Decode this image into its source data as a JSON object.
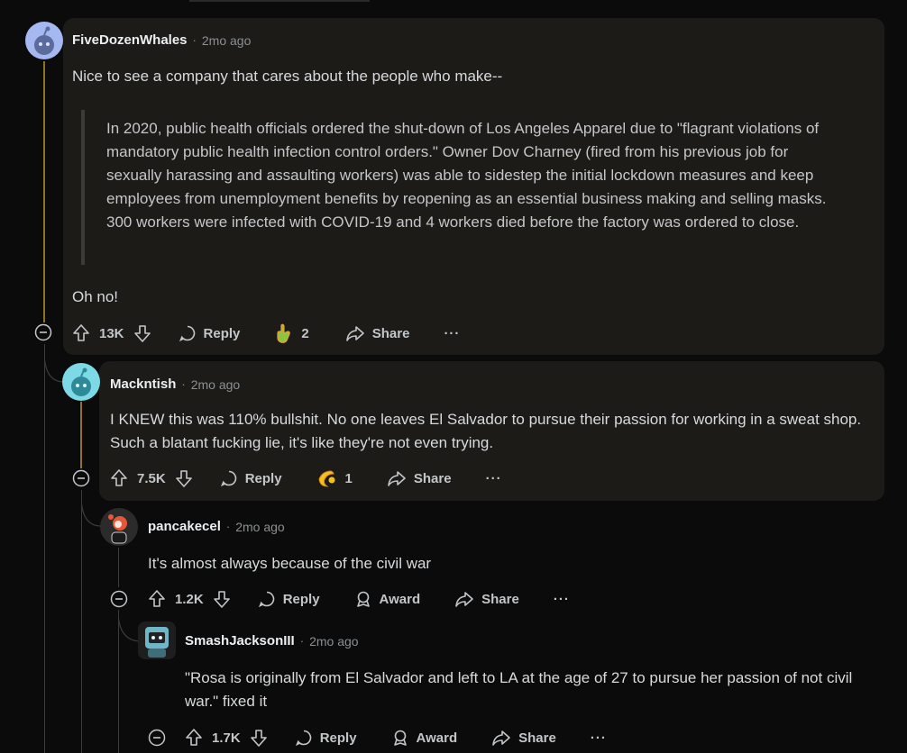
{
  "comments": [
    {
      "user": "FiveDozenWhales",
      "age": "2mo ago",
      "text1": "Nice to see a company that cares about the people who make--",
      "quote": "In 2020, public health officials ordered the shut-down of Los Angeles Apparel due to \"flagrant violations of mandatory public health infection control orders.\" Owner Dov Charney (fired from his previous job for sexually harassing and assaulting workers) was able to sidestep the initial lockdown measures and keep employees from unemployment benefits by reopening as an essential business making and selling masks. 300 workers were infected with COVID-19 and 4 workers died before the factory was ordered to close.",
      "text2": "Oh no!",
      "votes": "13K",
      "reply": "Reply",
      "award_count": "2",
      "share": "Share",
      "more": "···"
    },
    {
      "user": "Mackntish",
      "age": "2mo ago",
      "text": "I KNEW this was 110% bullshit. No one leaves El Salvador to pursue their passion for working in a sweat shop. Such a blatant fucking lie, it's like they're not even trying.",
      "votes": "7.5K",
      "reply": "Reply",
      "award_count": "1",
      "share": "Share",
      "more": "···"
    },
    {
      "user": "pancakecel",
      "age": "2mo ago",
      "text": "It's almost always because of the civil war",
      "votes": "1.2K",
      "reply": "Reply",
      "award": "Award",
      "share": "Share",
      "more": "···"
    },
    {
      "user": "SmashJacksonIII",
      "age": "2mo ago",
      "text": "\"Rosa is originally from El Salvador and left to LA at the age of 27 to pursue her passion of not civil war.\" fixed it",
      "votes": "1.7K",
      "reply": "Reply",
      "award": "Award",
      "share": "Share",
      "more": "···"
    }
  ],
  "separator": "·"
}
